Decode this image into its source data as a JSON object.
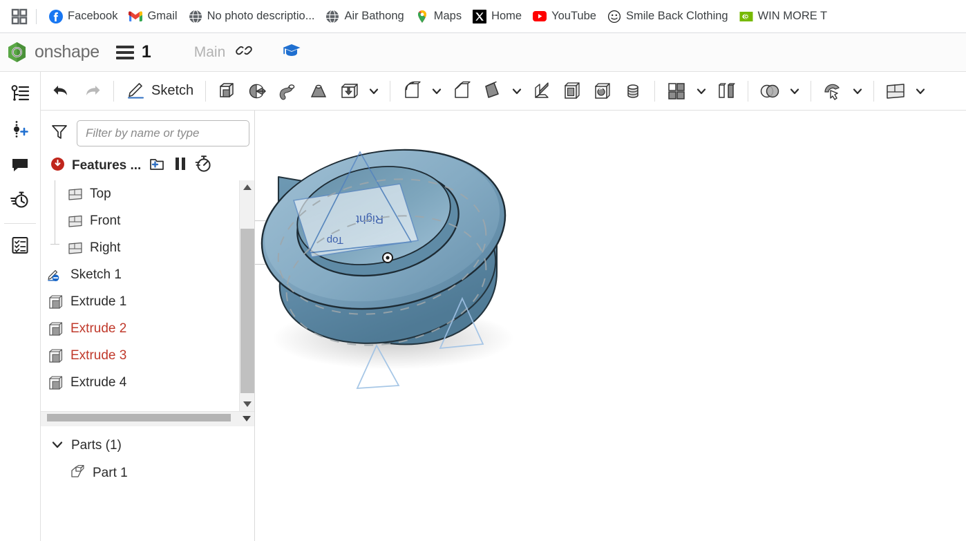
{
  "browser": {
    "apps_label": "apps-grid",
    "bookmarks": [
      {
        "label": "Facebook",
        "icon": "facebook-icon"
      },
      {
        "label": "Gmail",
        "icon": "gmail-icon"
      },
      {
        "label": "No photo descriptio...",
        "icon": "globe-icon"
      },
      {
        "label": "Air Bathong",
        "icon": "globe-icon"
      },
      {
        "label": "Maps",
        "icon": "google-maps-icon"
      },
      {
        "label": "Home",
        "icon": "x-twitter-icon"
      },
      {
        "label": "YouTube",
        "icon": "youtube-icon"
      },
      {
        "label": "Smile Back Clothing",
        "icon": "smiley-icon"
      },
      {
        "label": "WIN MORE T",
        "icon": "nvidia-icon"
      }
    ]
  },
  "header": {
    "brand": "onshape",
    "document_number": "1",
    "branch": "Main",
    "link_icon": "link-icon",
    "learn_icon": "graduation-cap-icon",
    "menu_icon": "hamburger-menu-icon"
  },
  "left_rail": {
    "items": [
      {
        "name": "feature-list-icon"
      },
      {
        "name": "insert-version-icon"
      },
      {
        "name": "comments-icon"
      },
      {
        "name": "history-icon"
      },
      {
        "name": "bill-of-materials-icon"
      }
    ]
  },
  "toolbar": {
    "undo_icon": "undo-icon",
    "redo_icon": "redo-icon",
    "sketch_label": "Sketch",
    "sketch_icon": "sketch-pencil-icon",
    "tools": [
      {
        "name": "extrude-icon",
        "caret": false
      },
      {
        "name": "revolve-icon",
        "caret": false
      },
      {
        "name": "sweep-icon",
        "caret": false
      },
      {
        "name": "loft-icon",
        "caret": false
      },
      {
        "name": "thicken-icon",
        "caret": true
      },
      {
        "name": "fillet-icon",
        "caret": true
      },
      {
        "name": "chamfer-icon",
        "caret": false
      },
      {
        "name": "draft-icon",
        "caret": true
      },
      {
        "name": "rib-icon",
        "caret": false
      },
      {
        "name": "shell-icon",
        "caret": false
      },
      {
        "name": "hole-icon",
        "caret": false
      },
      {
        "name": "cylindrical-pattern-icon",
        "caret": false
      },
      {
        "name": "linear-pattern-icon",
        "caret": true
      },
      {
        "name": "mirror-icon",
        "caret": false
      },
      {
        "name": "boolean-icon",
        "caret": true
      },
      {
        "name": "transform-icon",
        "caret": true
      },
      {
        "name": "plane-icon",
        "caret": true
      }
    ]
  },
  "tree": {
    "filter_placeholder": "Filter by name or type",
    "filter_value": "",
    "filter_icon": "filter-funnel-icon",
    "features_label": "Features ...",
    "features_error_icon": "error-badge-icon",
    "add_folder_icon": "add-folder-icon",
    "pause_icon": "rollback-pause-icon",
    "timer_icon": "regen-timer-icon",
    "items": [
      {
        "label": "Top",
        "icon": "plane-icon",
        "indent": true,
        "error": false,
        "badge": ""
      },
      {
        "label": "Front",
        "icon": "plane-icon",
        "indent": true,
        "error": false,
        "badge": ""
      },
      {
        "label": "Right",
        "icon": "plane-icon",
        "indent": true,
        "error": false,
        "badge": ""
      },
      {
        "label": "Sketch 1",
        "icon": "sketch-icon",
        "indent": false,
        "error": false,
        "badge": "hidden-badge"
      },
      {
        "label": "Extrude 1",
        "icon": "extrude-feature-icon",
        "indent": false,
        "error": false,
        "badge": ""
      },
      {
        "label": "Extrude 2",
        "icon": "extrude-feature-icon",
        "indent": false,
        "error": true,
        "badge": ""
      },
      {
        "label": "Extrude 3",
        "icon": "extrude-feature-icon",
        "indent": false,
        "error": true,
        "badge": ""
      },
      {
        "label": "Extrude 4",
        "icon": "extrude-feature-icon",
        "indent": false,
        "error": false,
        "badge": ""
      }
    ],
    "scroll_up_icon": "scroll-up-arrow-icon",
    "scroll_down_icon": "scroll-down-arrow-icon",
    "scroll_right_icon": "scroll-right-arrow-icon"
  },
  "parts": {
    "collapse_icon": "chevron-down-icon",
    "title": "Parts (1)",
    "items": [
      {
        "label": "Part 1",
        "icon": "part-body-icon"
      }
    ]
  },
  "viewport": {
    "panel_toggle_icon": "collapse-feature-list-icon",
    "model_name": "flanged-bushing-model"
  },
  "colors": {
    "brand_green": "#5aa746",
    "error_red": "#c0392b",
    "accent_blue": "#2f6fc1",
    "model_blue": "#7ba3bd",
    "model_blue_dark": "#5f8ba6",
    "model_blue_light": "#9cbdd2"
  }
}
